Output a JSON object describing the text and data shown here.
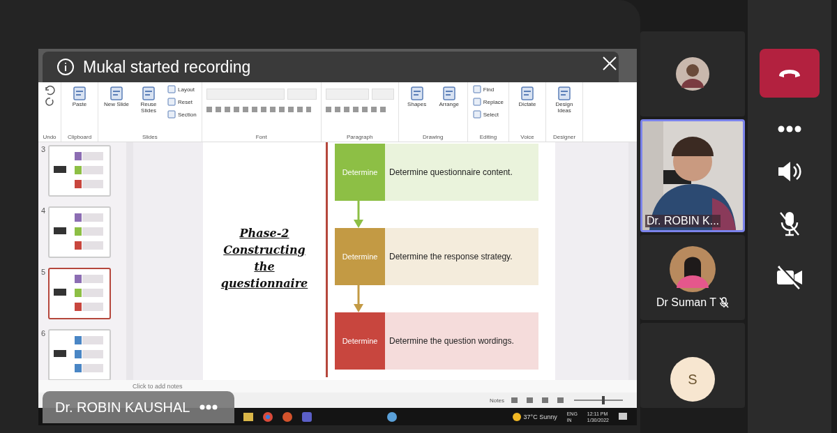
{
  "recording_banner": {
    "text": "Mukal started recording"
  },
  "ribbon_groups": [
    {
      "label": "Undo"
    },
    {
      "label": "Clipboard",
      "commands": [
        {
          "label": "Paste",
          "kind": "large"
        }
      ]
    },
    {
      "label": "Slides",
      "commands": [
        {
          "label": "New Slide",
          "kind": "large"
        },
        {
          "label": "Reuse Slides",
          "kind": "large"
        },
        {
          "label": "Layout",
          "kind": "small"
        },
        {
          "label": "Reset",
          "kind": "small"
        },
        {
          "label": "Section",
          "kind": "small"
        }
      ]
    },
    {
      "label": "Font"
    },
    {
      "label": "Paragraph"
    },
    {
      "label": "Drawing",
      "commands": [
        {
          "label": "Shapes",
          "kind": "large"
        },
        {
          "label": "Arrange",
          "kind": "large"
        }
      ]
    },
    {
      "label": "Editing",
      "commands": [
        {
          "label": "Find",
          "kind": "small"
        },
        {
          "label": "Replace",
          "kind": "small"
        },
        {
          "label": "Select",
          "kind": "small"
        }
      ]
    },
    {
      "label": "Voice",
      "commands": [
        {
          "label": "Dictate",
          "kind": "large"
        }
      ]
    },
    {
      "label": "Designer",
      "commands": [
        {
          "label": "Design Ideas",
          "kind": "large"
        }
      ]
    }
  ],
  "thumbnails": [
    {
      "number": "3",
      "selected": false
    },
    {
      "number": "4",
      "selected": false
    },
    {
      "number": "5",
      "selected": true
    },
    {
      "number": "6",
      "selected": false
    }
  ],
  "slide": {
    "title": "Phase-2 Constructing the questionnaire",
    "steps": [
      {
        "tag": "Determine",
        "text": "Determine questionnaire content.",
        "color": "#8dbf45"
      },
      {
        "tag": "Determine",
        "text": "Determine the response strategy.",
        "color": "#c39a44"
      },
      {
        "tag": "Determine",
        "text": "Determine the question wordings.",
        "color": "#c8463e"
      }
    ]
  },
  "notes_placeholder": "Click to add notes",
  "status_bar": {
    "notes": "Notes",
    "zoom_slider": {
      "level": 0.6
    }
  },
  "taskbar": {
    "weather": "37°C Sunny",
    "language": "ENG",
    "region": "IN",
    "time": "12:11 PM",
    "date": "1/30/2022"
  },
  "speaker_label": "Dr. ROBIN KAUSHAL",
  "participants": [
    {
      "kind": "avatar-small"
    },
    {
      "kind": "video",
      "name": "Dr. ROBIN K...",
      "selected": true
    },
    {
      "kind": "avatar",
      "name": "Dr Suman T",
      "muted": true
    },
    {
      "kind": "initial",
      "initial": "S"
    }
  ]
}
